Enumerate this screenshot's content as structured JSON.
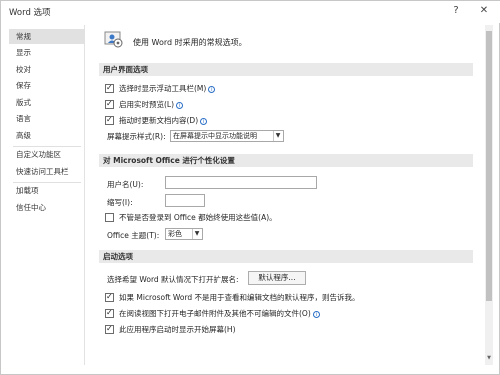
{
  "window": {
    "title": "Word 选项",
    "help_label": "?",
    "close_label": "✕"
  },
  "sidebar": {
    "items": [
      {
        "label": "常规"
      },
      {
        "label": "显示"
      },
      {
        "label": "校对"
      },
      {
        "label": "保存"
      },
      {
        "label": "版式"
      },
      {
        "label": "语言"
      },
      {
        "label": "高级"
      },
      {
        "label": "自定义功能区"
      },
      {
        "label": "快速访问工具栏"
      },
      {
        "label": "加载项"
      },
      {
        "label": "信任中心"
      }
    ],
    "selected": "常规"
  },
  "main": {
    "intro": "使用 Word 时采用的常规选项。",
    "ui_section": {
      "header": "用户界面选项",
      "options": [
        {
          "label": "选择时显示浮动工具栏(M)",
          "checked": true
        },
        {
          "label": "启用实时预览(L)",
          "checked": true
        },
        {
          "label": "拖动时更新文档内容(D)",
          "checked": true
        }
      ],
      "tooltip_label": "屏幕提示样式(R):",
      "tooltip_value": "在屏幕提示中显示功能说明"
    },
    "personalize_section": {
      "header": "对 Microsoft Office 进行个性化设置",
      "username_label": "用户名(U):",
      "username_value": "",
      "initials_label": "缩写(I):",
      "initials_value": "",
      "always_use_label": "不管是否登录到 Office 都始终使用这些值(A)。",
      "always_use_checked": false,
      "theme_label": "Office 主题(T):",
      "theme_value": "彩色"
    },
    "startup_section": {
      "header": "启动选项",
      "ext_label": "选择希望 Word 默认情况下打开扩展名:",
      "default_programs_label": "默认程序...",
      "options": [
        {
          "label": "如果 Microsoft Word 不是用于查看和编辑文档的默认程序，则告诉我。",
          "checked": true
        },
        {
          "label": "在阅读视图下打开电子邮件附件及其他不可编辑的文件(O)",
          "checked": true
        },
        {
          "label": "此应用程序启动时显示开始屏幕(H)",
          "checked": true
        }
      ]
    }
  }
}
